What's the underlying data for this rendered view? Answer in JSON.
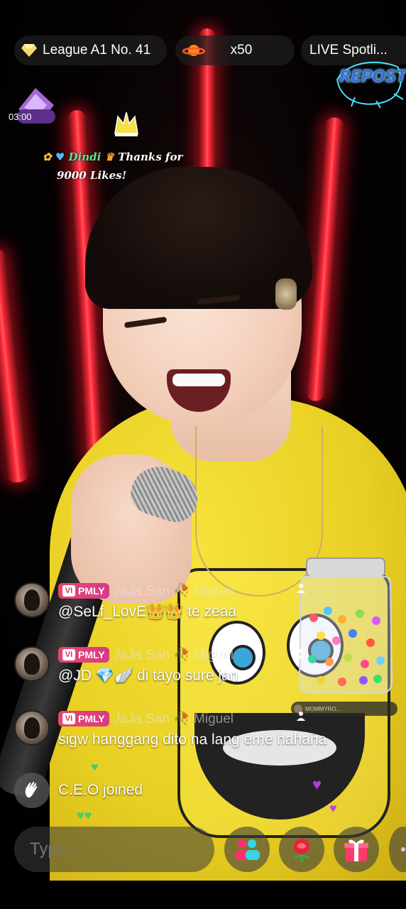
{
  "top_bar": {
    "league_label": "League A1 No. 41",
    "multiplier_label": "x50",
    "spotlight_label": "LIVE Spotli..."
  },
  "overlay": {
    "repost_label": "REPOST",
    "timer": "03:00"
  },
  "likes_banner": {
    "username": "Dindi",
    "message_line1": "Thanks for",
    "message_line2": "9000 Likes!"
  },
  "chat": {
    "messages": [
      {
        "badge": "PMLY",
        "sender": "JaJa San 🥀 Miguel",
        "text": "@SeLf_LovE👑👑 te zeaa"
      },
      {
        "badge": "PMLY",
        "sender": "JaJa San 🥀 Miguel",
        "text": "@JD 💎🪽 di tayo sure jan"
      },
      {
        "badge": "PMLY",
        "sender": "JaJa San 🥀 Miguel",
        "text": "sigw hanggang dito na lang eme hahaha"
      }
    ],
    "join": {
      "user": "C.E.O",
      "suffix": "joined"
    }
  },
  "jar_widget": {
    "users_label": "MOMMYRO..."
  },
  "bottom_bar": {
    "input_placeholder": "Type..."
  },
  "colors": {
    "accent_red": "#ff2a3a",
    "badge_pink": "#e6486a",
    "shirt_yellow": "#f6e23c"
  },
  "icons": {
    "league": "diamond-icon",
    "multiplier": "planet-icon",
    "guests": "people-icon",
    "rose": "rose-icon",
    "gift": "gift-icon",
    "join": "wave-hand-icon"
  }
}
